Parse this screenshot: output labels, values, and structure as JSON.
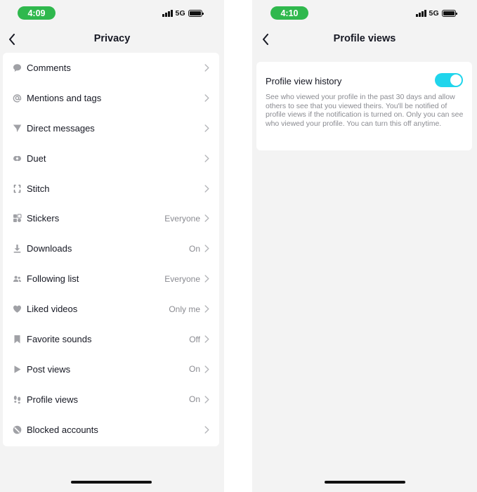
{
  "left_screen": {
    "status": {
      "time": "4:09",
      "network": "5G"
    },
    "title": "Privacy",
    "items": [
      {
        "label": "Comments",
        "value": "",
        "icon": "comment-icon"
      },
      {
        "label": "Mentions and tags",
        "value": "",
        "icon": "at-icon"
      },
      {
        "label": "Direct messages",
        "value": "",
        "icon": "send-icon"
      },
      {
        "label": "Duet",
        "value": "",
        "icon": "duet-icon"
      },
      {
        "label": "Stitch",
        "value": "",
        "icon": "stitch-icon"
      },
      {
        "label": "Stickers",
        "value": "Everyone",
        "icon": "sticker-icon"
      },
      {
        "label": "Downloads",
        "value": "On",
        "icon": "download-icon"
      },
      {
        "label": "Following list",
        "value": "Everyone",
        "icon": "users-icon"
      },
      {
        "label": "Liked videos",
        "value": "Only me",
        "icon": "heart-icon"
      },
      {
        "label": "Favorite sounds",
        "value": "Off",
        "icon": "bookmark-icon"
      },
      {
        "label": "Post views",
        "value": "On",
        "icon": "play-icon"
      },
      {
        "label": "Profile views",
        "value": "On",
        "icon": "footprint-icon"
      },
      {
        "label": "Blocked accounts",
        "value": "",
        "icon": "block-icon"
      }
    ]
  },
  "right_screen": {
    "status": {
      "time": "4:10",
      "network": "5G"
    },
    "title": "Profile views",
    "setting": {
      "title": "Profile view history",
      "description": "See who viewed your profile in the past 30 days and allow others to see that you viewed theirs. You'll be notified of profile views if the notification is turned on. Only you can see who viewed your profile. You can turn this off anytime.",
      "enabled": true
    }
  },
  "colors": {
    "status_pill": "#2fb84d",
    "toggle_on": "#20d5ec",
    "background": "#f3f3f3",
    "secondary_text": "#8a8b91"
  }
}
